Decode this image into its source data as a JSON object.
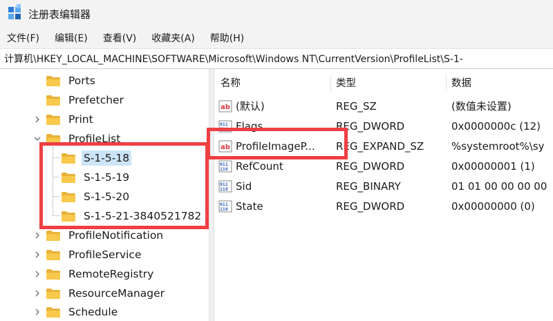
{
  "window": {
    "title": "注册表编辑器"
  },
  "menu": [
    {
      "id": "file",
      "label": "文件(F)"
    },
    {
      "id": "edit",
      "label": "编辑(E)"
    },
    {
      "id": "view",
      "label": "查看(V)"
    },
    {
      "id": "favorites",
      "label": "收藏夹(A)"
    },
    {
      "id": "help",
      "label": "帮助(H)"
    }
  ],
  "address": {
    "path": "计算机\\HKEY_LOCAL_MACHINE\\SOFTWARE\\Microsoft\\Windows NT\\CurrentVersion\\ProfileList\\S-1-"
  },
  "tree": {
    "items": [
      {
        "id": "ports",
        "label": "Ports",
        "expandable": false,
        "expanded": false,
        "level": 0
      },
      {
        "id": "prefetcher",
        "label": "Prefetcher",
        "expandable": false,
        "expanded": false,
        "level": 0
      },
      {
        "id": "print",
        "label": "Print",
        "expandable": true,
        "expanded": false,
        "level": 0
      },
      {
        "id": "profilelist",
        "label": "ProfileList",
        "expandable": true,
        "expanded": true,
        "level": 0
      },
      {
        "id": "s-1-5-18",
        "label": "S-1-5-18",
        "expandable": false,
        "expanded": false,
        "level": 1,
        "selected": true
      },
      {
        "id": "s-1-5-19",
        "label": "S-1-5-19",
        "expandable": false,
        "expanded": false,
        "level": 1
      },
      {
        "id": "s-1-5-20",
        "label": "S-1-5-20",
        "expandable": false,
        "expanded": false,
        "level": 1
      },
      {
        "id": "s-1-5-21",
        "label": "S-1-5-21-3840521782",
        "expandable": false,
        "expanded": false,
        "level": 1
      },
      {
        "id": "profilenotification",
        "label": "ProfileNotification",
        "expandable": true,
        "expanded": false,
        "level": 0
      },
      {
        "id": "profileservice",
        "label": "ProfileService",
        "expandable": true,
        "expanded": false,
        "level": 0
      },
      {
        "id": "remoteregistry",
        "label": "RemoteRegistry",
        "expandable": true,
        "expanded": false,
        "level": 0
      },
      {
        "id": "resourcemanager",
        "label": "ResourceManager",
        "expandable": true,
        "expanded": false,
        "level": 0
      },
      {
        "id": "schedule",
        "label": "Schedule",
        "expandable": true,
        "expanded": false,
        "level": 0
      }
    ]
  },
  "values": {
    "columns": {
      "name": "名称",
      "type": "类型",
      "data": "数据"
    },
    "rows": [
      {
        "icon": "string-value-icon",
        "name": "(默认)",
        "type": "REG_SZ",
        "data": "(数值未设置)"
      },
      {
        "icon": "binary-value-icon",
        "name": "Flags",
        "type": "REG_DWORD",
        "data": "0x0000000c (12)"
      },
      {
        "icon": "string-value-icon",
        "name": "ProfileImageP...",
        "type": "REG_EXPAND_SZ",
        "data": "%systemroot%\\sy"
      },
      {
        "icon": "binary-value-icon",
        "name": "RefCount",
        "type": "REG_DWORD",
        "data": "0x00000001 (1)"
      },
      {
        "icon": "binary-value-icon",
        "name": "Sid",
        "type": "REG_BINARY",
        "data": "01 01 00 00 00 00"
      },
      {
        "icon": "binary-value-icon",
        "name": "State",
        "type": "REG_DWORD",
        "data": "0x00000000 (0)"
      }
    ]
  },
  "colors": {
    "highlight": "#ee3f43",
    "selection": "#cce4f7",
    "folder": "#f8c94c",
    "chrome": "#f3f3f3"
  }
}
